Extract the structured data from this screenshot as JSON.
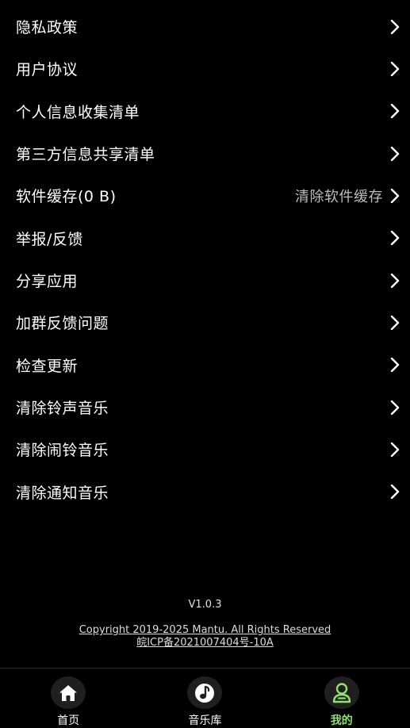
{
  "colors": {
    "background": "#000000",
    "text": "#ffffff",
    "secondary_text": "#bdbdbd",
    "accent": "#8fe36a",
    "tab_icon_bg": "#1f1f1f"
  },
  "menu": {
    "items": [
      {
        "label": "隐私政策",
        "icon": "chevron-right-icon"
      },
      {
        "label": "用户协议",
        "icon": "chevron-right-icon"
      },
      {
        "label": "个人信息收集清单",
        "icon": "chevron-right-icon"
      },
      {
        "label": "第三方信息共享清单",
        "icon": "chevron-right-icon"
      },
      {
        "label": "软件缓存(0 B)",
        "extra": "清除软件缓存",
        "icon": "chevron-right-icon"
      },
      {
        "label": "举报/反馈",
        "icon": "chevron-right-icon"
      },
      {
        "label": "分享应用",
        "icon": "chevron-right-icon"
      },
      {
        "label": "加群反馈问题",
        "icon": "chevron-right-icon"
      },
      {
        "label": "检查更新",
        "icon": "chevron-right-icon"
      },
      {
        "label": "清除铃声音乐",
        "icon": "chevron-right-icon"
      },
      {
        "label": "清除闹铃音乐",
        "icon": "chevron-right-icon"
      },
      {
        "label": "清除通知音乐",
        "icon": "chevron-right-icon"
      }
    ]
  },
  "footer": {
    "version": "V1.0.3",
    "copyright": "Copyright  2019-2025 Mantu. All Rights Reserved ",
    "icp": "皖ICP备2021007404号-10A"
  },
  "tabbar": {
    "tabs": [
      {
        "label": "首页",
        "icon": "home-icon",
        "active": false
      },
      {
        "label": "音乐库",
        "icon": "music-note-icon",
        "active": false
      },
      {
        "label": "我的",
        "icon": "user-icon",
        "active": true
      }
    ]
  }
}
